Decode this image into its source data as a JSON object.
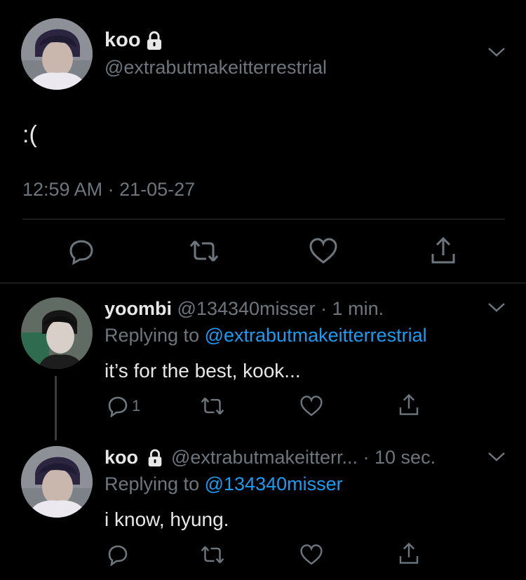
{
  "main_tweet": {
    "display_name": "koo",
    "handle": "@extrabutmakeitterrestrial",
    "text": ":(",
    "timestamp": "12:59 AM · 21-05-27",
    "icons": [
      "lock-icon",
      "chevron-down-icon",
      "reply-icon",
      "retweet-icon",
      "like-icon",
      "share-icon"
    ]
  },
  "replies": [
    {
      "display_name": "yoombi",
      "handle": "@134340misser",
      "time": "· 1 min.",
      "replying_prefix": "Replying to",
      "replying_to": "@extrabutmakeitterrestrial",
      "text": "it’s for the best, kook...",
      "reply_count": "1"
    },
    {
      "display_name": "koo",
      "handle": "@extrabutmakeitterr...",
      "time": "· 10 sec.",
      "replying_prefix": "Replying to",
      "replying_to": "@134340misser",
      "text": "i know, hyung.",
      "reply_count": ""
    }
  ],
  "colors": {
    "background": "#000000",
    "text": "#d9d9d9",
    "muted": "#6e767d",
    "link": "#1d9bf0",
    "divider": "#2f3336"
  }
}
